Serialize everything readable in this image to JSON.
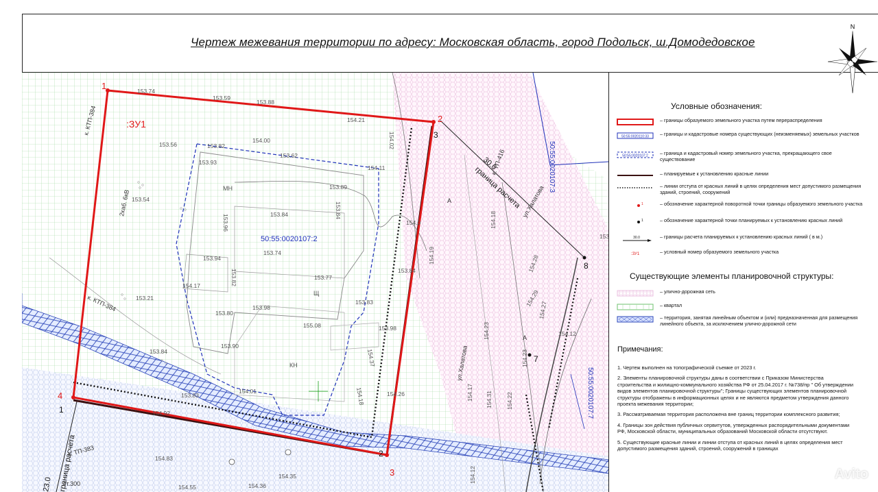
{
  "title": "Чертеж  межевания территории по адресу: Московская область, город Подольск, ш.Домодедовское",
  "map": {
    "parcel_label": ":ЗУ1",
    "cadastral_main": "50:55:0020107:2",
    "cadastral_east_top": "50:55:0020107:3",
    "cadastral_east_bottom": "50:55:0020107:7",
    "calc_boundary": "граница расчета",
    "calc_distance": "30.0",
    "calc_boundary_left": "граница расчета",
    "calc_distance_left": "23.0",
    "street_1": "ул.Халатова",
    "street_2": "ул.Халатова",
    "labels": {
      "mn": "МН",
      "kn": "КН",
      "sh": "Щ",
      "ktp384a": "к. КТП-384",
      "ktp384b": "к. КТП-384",
      "ktp416": "к. ТП-416",
      "tp383": "к. ТП-383",
      "cable": "2каб. 6кВ",
      "st300": "ст.300",
      "a1": "А",
      "a2": "А"
    },
    "points": {
      "p1": "1",
      "p2": "2",
      "p3": "3",
      "p4": "4",
      "b1": "1",
      "b2": "2",
      "b3": "3",
      "b7": "7",
      "b8": "8"
    },
    "elevations": [
      "153.74",
      "153.59",
      "153.88",
      "154.21",
      "154.02",
      "153.56",
      "153.82",
      "154.00",
      "153.62",
      "153.93",
      "154.11",
      "153.54",
      "153.89",
      "153.84",
      "153.96",
      "153.84",
      "153.94",
      "153.74",
      "153.82",
      "153.77",
      "154.17",
      "153.21",
      "153.83",
      "153.80",
      "153.98",
      "155.08",
      "153.98",
      "153.90",
      "153.84",
      "154.01",
      "153.83",
      "154.92",
      "154.26",
      "154.83",
      "154.55",
      "154.35",
      "154.36",
      "154.19",
      "154.18",
      "154.28",
      "154.23",
      "154.29",
      "154.27",
      "154.12",
      "154.23",
      "154.17",
      "154.31",
      "154.22",
      "154.12",
      "154.0",
      "153.84",
      "154.37",
      "154.18",
      "153.48"
    ]
  },
  "legend": {
    "heading": "Условные обозначения:",
    "items": [
      {
        "text": "– границы образуемого земельного участка путем перераспределения"
      },
      {
        "text": "– границы и кадастровые номера существующих (неизменяемых) земельных участков",
        "code": "50:55:0020110:33"
      },
      {
        "text": "– граница и кадастровый номер земельного участка, прекращающего свое существование",
        "code": "50:55:0020107:2"
      },
      {
        "text": "– планируемые к установлению красные линии"
      },
      {
        "text": "– линии отступа от красных линий в целях определения мест допустимого размещения зданий, строений, сооружений"
      },
      {
        "text": "– обозначение характерной поворотной точки границы образуемого земельного участка",
        "code": "1"
      },
      {
        "text": "– обозначение характерной точки планируемых к установлению красных линий",
        "code": "1"
      },
      {
        "text": "– границы расчета планируемых к установлению красных линий ( в м.)",
        "code": "30.0"
      },
      {
        "text": "– условный номер образуемого земельного участка",
        "code": ":ЗУ1"
      }
    ],
    "heading2": "Существующие элементы планировочной структуры:",
    "items2": [
      {
        "text": "– улично-дорожная сеть"
      },
      {
        "text": "– квартал"
      },
      {
        "text": "– территория, занятая линейным объектом и (или) предназначенная для размещения линейного объекта, за исключением улично-дорожной сети"
      }
    ],
    "notes_heading": "Примечания:",
    "notes": [
      "1. Чертеж выполнен на топографической съемке от 2023 г.",
      "2. Элементы планировочной структуры  даны в соответствии с Приказом Министерства строительства и жилищно-коммунального хозяйства РФ  от 25.04.2017 г. №738/пр \" Об утверждении  видов элементов планировочной структуры\"; Границы существующих элементов планировочной структуры отображены в информационных  целях и не являются предметом утверждения данного проекта межевания территории;",
      "3.  Рассматриваемая территория расположена вне границ территории  комплексного развития;",
      "4.  Границы зон действия публичных сервитутов, утвержденных распорядительными документами РФ, Московской области, муниципальных образований Московской области отсутствуют.",
      "5. Существующие красные линии и линии отступа  от красных линий в целях определения мест допустимого размещения зданий, строений, сооружений в границах"
    ]
  },
  "compass": {
    "north": "N"
  },
  "watermark": "Avito",
  "colors": {
    "parcel": "#e01818",
    "redline": "#111111",
    "cadastral": "#1c2fb8",
    "grid": "#8fd08f",
    "road": "#e8a7d6"
  }
}
